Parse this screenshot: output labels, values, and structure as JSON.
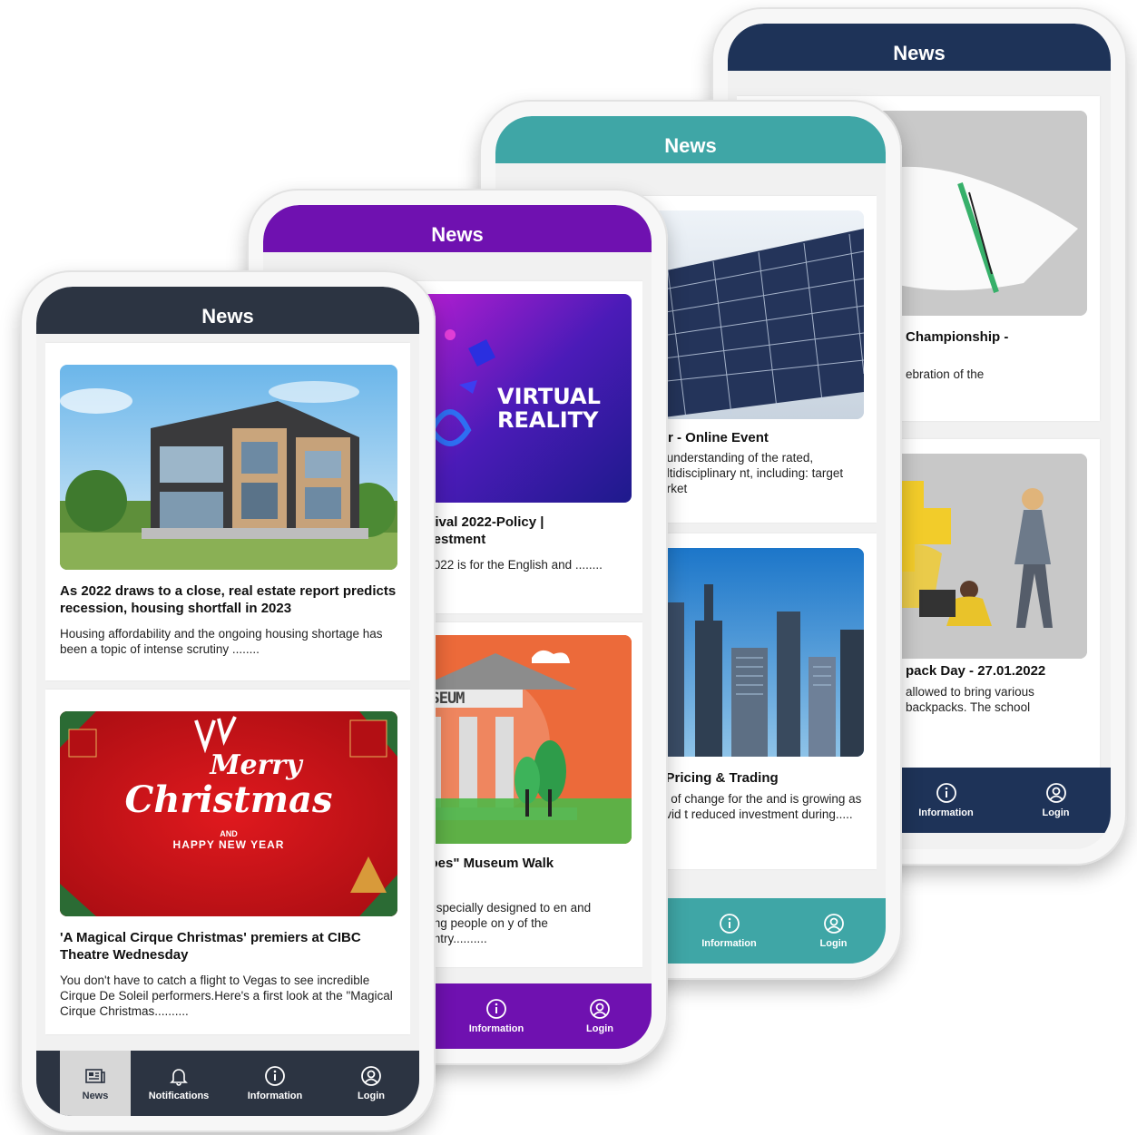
{
  "phones": {
    "navy": {
      "header": "News",
      "color": "#1e3358",
      "cards": [
        {
          "title": "Championship -",
          "desc": "ebration of the"
        },
        {
          "title": "pack Day - 27.01.2022",
          "desc": "allowed to bring various backpacks. The school"
        }
      ],
      "nav": [
        "Information",
        "Login"
      ]
    },
    "teal": {
      "header": "News",
      "color": "#3fa6a6",
      "cards": [
        {
          "title": "wer - Online Event",
          "desc": "od understanding of the rated, multidisciplinary nt, including: target market"
        },
        {
          "title": "d, Pricing & Trading",
          "desc": "ear of change for the and is growing as Covid t reduced investment during....."
        }
      ],
      "nav": [
        "s",
        "Information",
        "Login"
      ]
    },
    "purple": {
      "header": "News",
      "color": "#6f11b0",
      "cards": [
        {
          "title": "arnival 2022-Policy | Investment",
          "desc": "al 2022 is for the English and ........"
        },
        {
          "title": "faloes\" Museum Walk",
          "desc": "alk, specially designed to en and young people on y of the country.........."
        }
      ],
      "nav": [
        "s",
        "Information",
        "Login"
      ],
      "vr_text_1": "VIRTUAL",
      "vr_text_2": "REALITY",
      "museum_text": "MUSEUM"
    },
    "dark": {
      "header": "News",
      "color": "#2c3442",
      "cards": [
        {
          "title": "As 2022 draws to a close, real estate report predicts recession, housing shortfall in 2023",
          "desc": "Housing affordability and the ongoing housing shortage has been a topic of intense scrutiny ........"
        },
        {
          "title": "'A Magical Cirque Christmas' premiers at CIBC Theatre Wednesday",
          "desc": "You don't have to catch a flight to Vegas to see incredible Cirque De Soleil performers.Here's a first look at the \"Magical Cirque Christmas.........."
        }
      ],
      "nav": [
        "News",
        "Notifications",
        "Information",
        "Login"
      ],
      "xmas_line1": "Merry",
      "xmas_line2": "Christmas",
      "xmas_and": "AND",
      "xmas_new_year": "HAPPY NEW YEAR"
    }
  },
  "icons": [
    "newspaper-icon",
    "bell-icon",
    "info-icon",
    "user-icon"
  ]
}
